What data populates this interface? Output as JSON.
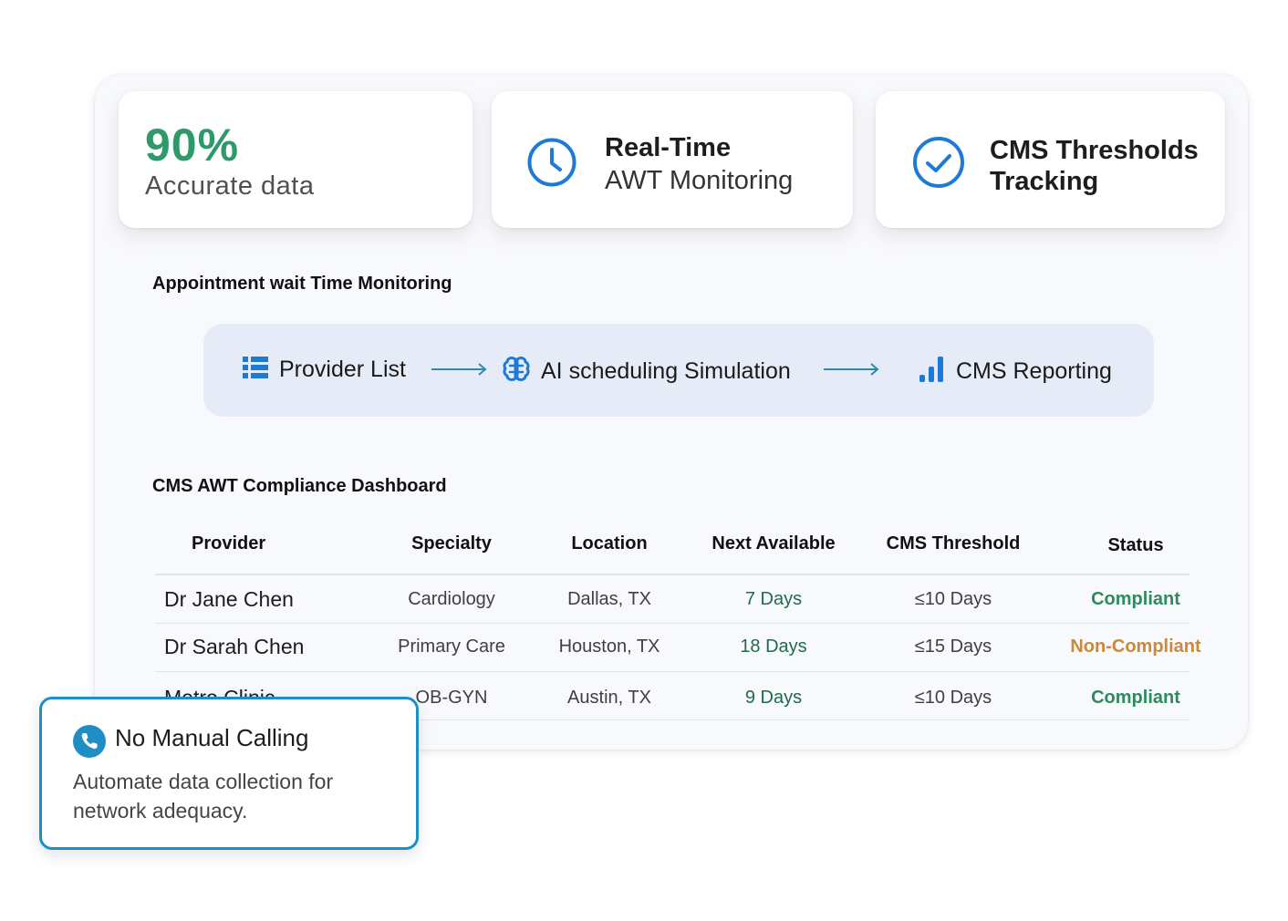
{
  "stats": {
    "accuracy": {
      "value": "90%",
      "caption": "Accurate data"
    },
    "realtime": {
      "title": "Real-Time",
      "subtitle": "AWT Monitoring",
      "icon": "clock-icon"
    },
    "cms": {
      "title": "CMS Thresholds Tracking",
      "icon": "check-circle-icon"
    }
  },
  "workflow": {
    "heading": "Appointment wait Time Monitoring",
    "steps": [
      {
        "label": "Provider List",
        "icon": "list-icon"
      },
      {
        "label": "AI scheduling Simulation",
        "icon": "brain-icon"
      },
      {
        "label": "CMS Reporting",
        "icon": "bar-chart-icon"
      }
    ]
  },
  "dashboard": {
    "heading": "CMS AWT Compliance Dashboard",
    "columns": [
      "Provider",
      "Specialty",
      "Location",
      "Next Available",
      "CMS Threshold",
      "Status"
    ],
    "rows": [
      {
        "provider": "Dr Jane Chen",
        "specialty": "Cardiology",
        "location": "Dallas, TX",
        "next": "7 Days",
        "threshold": "≤10 Days",
        "status": "Compliant"
      },
      {
        "provider": "Dr Sarah Chen",
        "specialty": "Primary Care",
        "location": "Houston, TX",
        "next": "18 Days",
        "threshold": "≤15 Days",
        "status": "Non-Compliant"
      },
      {
        "provider": "Metro Clinic",
        "specialty": "OB-GYN",
        "location": "Austin, TX",
        "next": "9 Days",
        "threshold": "≤10 Days",
        "status": "Compliant"
      }
    ]
  },
  "callout": {
    "title": "No Manual Calling",
    "body": "Automate data collection for network adequacy.",
    "icon": "phone-icon"
  },
  "colors": {
    "accent_green": "#2e9a6a",
    "icon_blue": "#1f7ad6",
    "flow_bg": "#e5ecf8",
    "compliant": "#2e8a5f",
    "non_compliant": "#c98a3c",
    "callout_border": "#1b8fc9"
  }
}
